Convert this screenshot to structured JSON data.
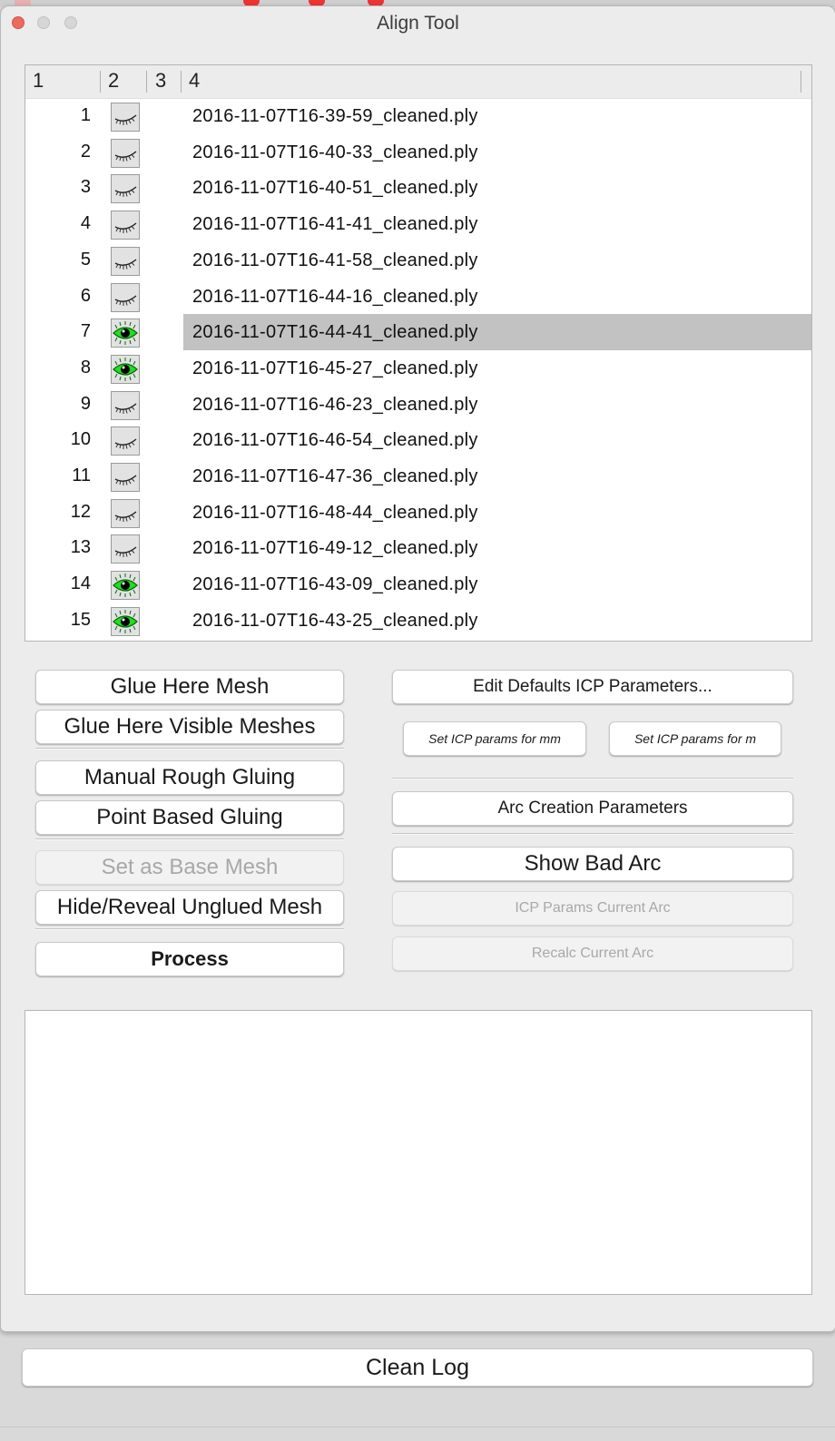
{
  "window": {
    "title": "Align Tool"
  },
  "table": {
    "headers": [
      "1",
      "2",
      "3",
      "4"
    ],
    "rows": [
      {
        "num": "1",
        "visible": false,
        "file": "2016-11-07T16-39-59_cleaned.ply"
      },
      {
        "num": "2",
        "visible": false,
        "file": "2016-11-07T16-40-33_cleaned.ply"
      },
      {
        "num": "3",
        "visible": false,
        "file": "2016-11-07T16-40-51_cleaned.ply"
      },
      {
        "num": "4",
        "visible": false,
        "file": "2016-11-07T16-41-41_cleaned.ply"
      },
      {
        "num": "5",
        "visible": false,
        "file": "2016-11-07T16-41-58_cleaned.ply"
      },
      {
        "num": "6",
        "visible": false,
        "file": "2016-11-07T16-44-16_cleaned.ply"
      },
      {
        "num": "7",
        "visible": true,
        "file": "2016-11-07T16-44-41_cleaned.ply",
        "selected": true
      },
      {
        "num": "8",
        "visible": true,
        "file": "2016-11-07T16-45-27_cleaned.ply"
      },
      {
        "num": "9",
        "visible": false,
        "file": "2016-11-07T16-46-23_cleaned.ply"
      },
      {
        "num": "10",
        "visible": false,
        "file": "2016-11-07T16-46-54_cleaned.ply"
      },
      {
        "num": "11",
        "visible": false,
        "file": "2016-11-07T16-47-36_cleaned.ply"
      },
      {
        "num": "12",
        "visible": false,
        "file": "2016-11-07T16-48-44_cleaned.ply"
      },
      {
        "num": "13",
        "visible": false,
        "file": "2016-11-07T16-49-12_cleaned.ply"
      },
      {
        "num": "14",
        "visible": true,
        "file": "2016-11-07T16-43-09_cleaned.ply"
      },
      {
        "num": "15",
        "visible": true,
        "file": "2016-11-07T16-43-25_cleaned.ply"
      }
    ],
    "icons": {
      "open": "eye-open-icon",
      "closed": "eye-closed-icon"
    },
    "colors": {
      "selected_row": "#c2c2c2",
      "eye_green": "#22dd22"
    }
  },
  "left_buttons": {
    "glue_here_mesh": "Glue Here Mesh",
    "glue_here_visible": "Glue Here Visible Meshes",
    "manual_rough": "Manual Rough Gluing",
    "point_based": "Point Based Gluing",
    "set_base": "Set as Base Mesh",
    "hide_reveal": "Hide/Reveal Unglued Mesh",
    "process": "Process"
  },
  "right_buttons": {
    "edit_defaults": "Edit Defaults ICP Parameters...",
    "icp_mm": "Set ICP params for mm",
    "icp_m": "Set ICP params for m",
    "arc_creation": "Arc Creation Parameters",
    "show_bad_arc": "Show Bad Arc",
    "icp_current_arc": "ICP Params Current Arc",
    "recalc_arc": "Recalc Current Arc"
  },
  "log": {
    "text": ""
  },
  "bottom": {
    "clean_log": "Clean Log"
  }
}
